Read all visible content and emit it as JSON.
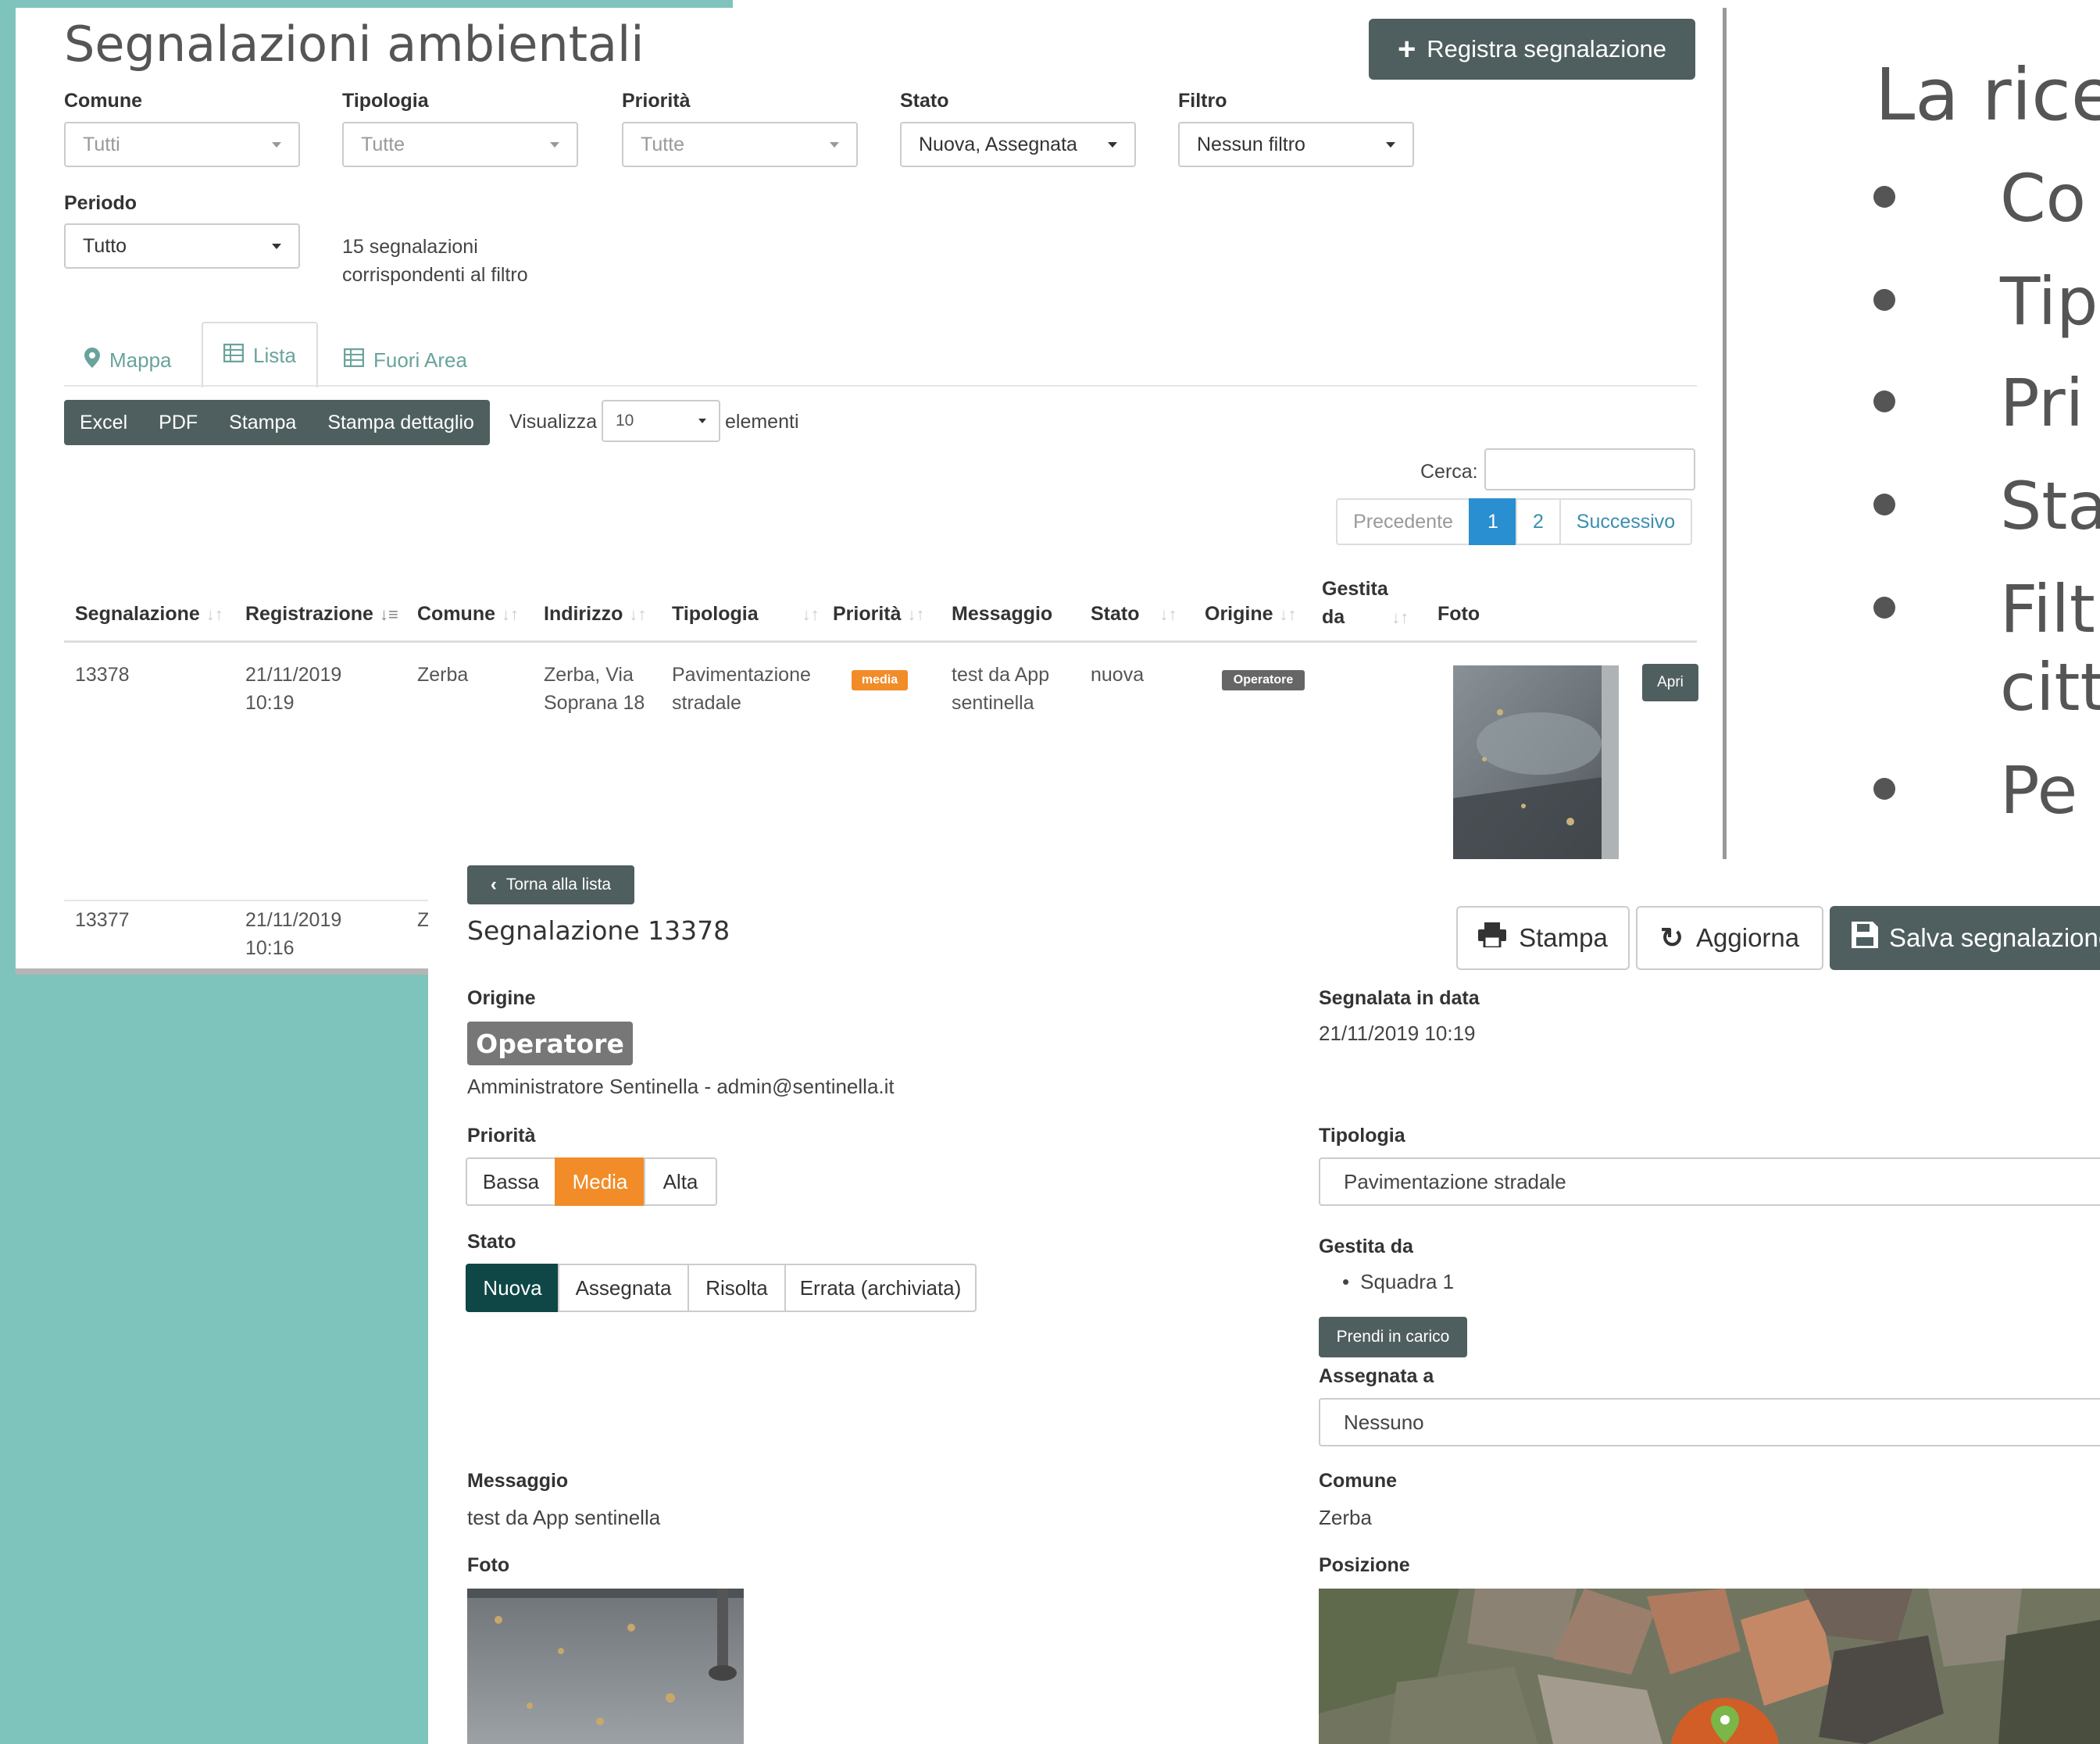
{
  "list": {
    "title": "Segnalazioni ambientali",
    "register_button": "Registra segnalazione",
    "filters": [
      {
        "label": "Comune",
        "value": "Tutti"
      },
      {
        "label": "Tipologia",
        "value": "Tutte"
      },
      {
        "label": "Priorità",
        "value": "Tutte"
      },
      {
        "label": "Stato",
        "value": "Nuova, Assegnata"
      },
      {
        "label": "Filtro",
        "value": "Nessun filtro"
      }
    ],
    "period": {
      "label": "Periodo",
      "value": "Tutto"
    },
    "count_line1": "15 segnalazioni",
    "count_line2": "corrispondenti al filtro",
    "tabs": [
      "Mappa",
      "Lista",
      "Fuori Area"
    ],
    "export_buttons": [
      "Excel",
      "PDF",
      "Stampa",
      "Stampa dettaglio"
    ],
    "show_label": "Visualizza",
    "show_value": "10",
    "show_suffix": "elementi",
    "search_label": "Cerca:",
    "pagination": {
      "prev": "Precedente",
      "pages": [
        "1",
        "2"
      ],
      "active_page": "1",
      "next": "Successivo"
    },
    "columns": [
      "Segnalazione",
      "Registrazione",
      "Comune",
      "Indirizzo",
      "Tipologia",
      "Priorità",
      "Messaggio",
      "Stato",
      "Origine",
      "Gestita",
      "da",
      "Foto"
    ],
    "rows": [
      {
        "id": "13378",
        "date": "21/11/2019",
        "time": "10:19",
        "comune": "Zerba",
        "addr1": "Zerba, Via",
        "addr2": "Soprana 18",
        "tip1": "Pavimentazione",
        "tip2": "stradale",
        "priority_badge": "media",
        "msg1": "test da App",
        "msg2": "sentinella",
        "stato": "nuova",
        "origine_badge": "Operatore",
        "open_button": "Apri"
      },
      {
        "id": "13377",
        "date": "21/11/2019",
        "time": "10:16",
        "comune_fragment": "Z"
      }
    ]
  },
  "slide": {
    "title_fragment": "La rice",
    "bullets": [
      "Co",
      "Tip",
      "Pri",
      "Sta",
      "Filt",
      "citt",
      "Pe"
    ]
  },
  "detail": {
    "back_button": "Torna alla lista",
    "title": "Segnalazione 13378",
    "print_button": "Stampa",
    "refresh_button": "Aggiorna",
    "save_button": "Salva segnalazione",
    "origine_label": "Origine",
    "origine_badge": "Operatore",
    "origine_user": "Amministratore Sentinella - admin@sentinella.it",
    "priority_label": "Priorità",
    "priority_options": [
      "Bassa",
      "Media",
      "Alta"
    ],
    "priority_selected": "Media",
    "state_label": "Stato",
    "state_options": [
      "Nuova",
      "Assegnata",
      "Risolta",
      "Errata (archiviata)"
    ],
    "state_selected": "Nuova",
    "message_label": "Messaggio",
    "message": "test da App sentinella",
    "photo_label": "Foto",
    "reported_label": "Segnalata in data",
    "reported_value": "21/11/2019 10:19",
    "type_label": "Tipologia",
    "type_value": "Pavimentazione stradale",
    "managed_label": "Gestita da",
    "managed_items": [
      "Squadra 1"
    ],
    "take_button": "Prendi in carico",
    "assigned_label": "Assegnata a",
    "assigned_value": "Nessuno",
    "comune_label": "Comune",
    "comune_value": "Zerba",
    "position_label": "Posizione"
  },
  "colors": {
    "teal_background": "#7fc4bc",
    "dark_button": "#4f5e5e",
    "accent_orange": "#f28c28",
    "state_selected": "#0f4747",
    "pager_active": "#2a8fd0"
  }
}
